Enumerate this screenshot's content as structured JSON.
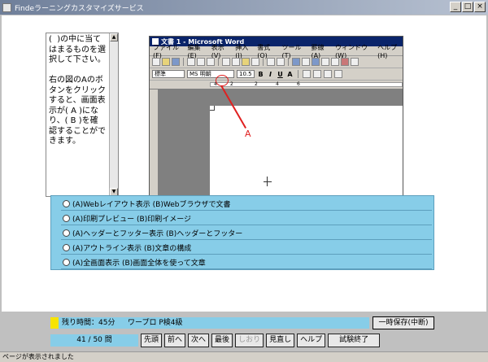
{
  "window": {
    "title": "Findeラーニングカスタマイズサービス",
    "min": "_",
    "max": "□",
    "close": "×"
  },
  "instruction": {
    "text": "(  )の中に当て\nはまるものを選\n択して下さい。\n\n右の図のAのボ\nタンをクリック\nすると、画面表\n示が( A )にな\nり、( B )を確\n認することがで\nきます。"
  },
  "word": {
    "title": "文書 1 - Microsoft Word",
    "menu": [
      "ファイル(F)",
      "編集(E)",
      "表示(V)",
      "挿入(I)",
      "書式(O)",
      "ツール(T)",
      "罫線(A)",
      "ウィンドウ(W)",
      "ヘルプ(H)"
    ],
    "style": "標準",
    "font": "MS 明朝",
    "size": "10.5",
    "format_buttons": [
      "B",
      "I",
      "U",
      "A"
    ],
    "ruler_marks": [
      "4",
      "2",
      "2",
      "4",
      "6"
    ],
    "pointer_label": "A"
  },
  "choices": [
    "(A)Webレイアウト表示 (B)Webブラウザで文書",
    "(A)印刷プレビュー (B)印刷イメージ",
    "(A)ヘッダーとフッター表示 (B)ヘッダーとフッター",
    "(A)アウトライン表示 (B)文章の構成",
    "(A)全画面表示 (B)画面全体を使って文章"
  ],
  "status": {
    "time": "残り時間：45分",
    "level": "ワープロ P検4級",
    "save": "一時保存(中断)"
  },
  "nav": {
    "page": "41 / 50 問",
    "first": "先頭",
    "prev": "前へ",
    "next": "次へ",
    "last": "最後",
    "bookmark": "しおり",
    "review": "見直し",
    "help": "ヘルプ",
    "finish": "試験終了"
  },
  "statusbar": "ページが表示されました"
}
